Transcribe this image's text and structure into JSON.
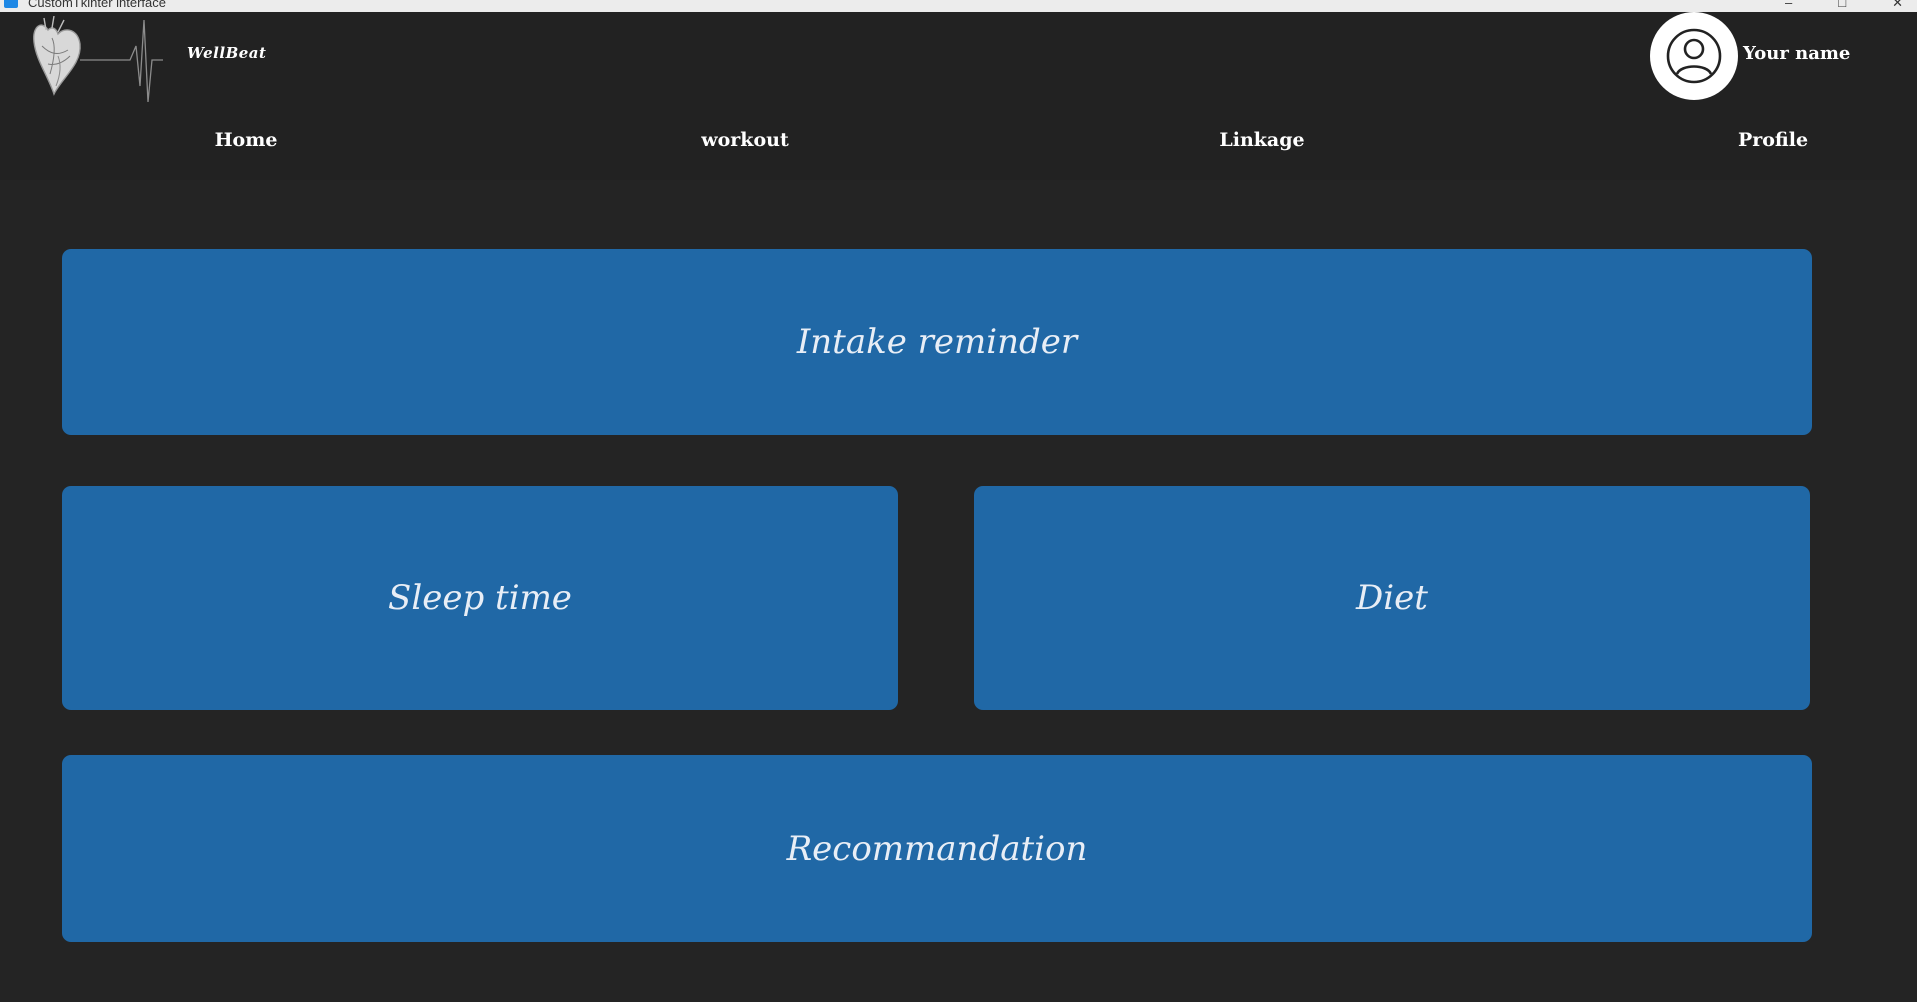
{
  "window": {
    "title": "CustomTkinter interface",
    "controls": [
      "–",
      "□",
      "✕"
    ]
  },
  "header": {
    "brand": "WellBeat",
    "logo_icon": "heart-ecg-logo-icon",
    "avatar_icon": "user-avatar-icon",
    "username": "Your name"
  },
  "nav": {
    "home": "Home",
    "workout": "workout",
    "linkage": "Linkage",
    "profile": "Profile"
  },
  "cards": {
    "intake": "Intake reminder",
    "sleep": "Sleep time",
    "diet": "Diet",
    "recommendation": "Recommandation"
  },
  "colors": {
    "background": "#242424",
    "header": "#222222",
    "card": "#2068a6",
    "text": "#ffffff"
  }
}
